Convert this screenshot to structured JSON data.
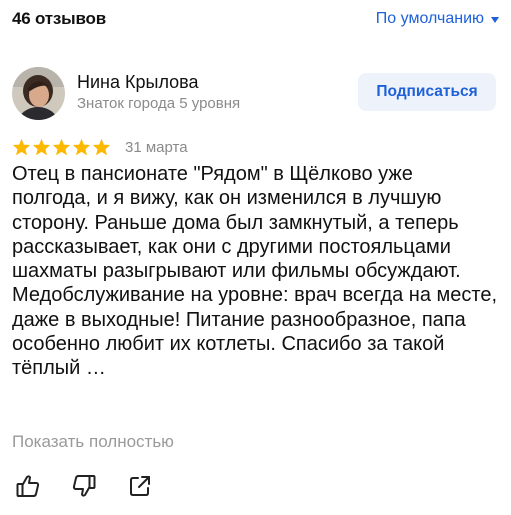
{
  "header": {
    "reviews_count": "46 отзывов",
    "sort_label": "По умолчанию"
  },
  "author": {
    "name": "Нина Крылова",
    "level": "Знаток города 5 уровня",
    "subscribe_label": "Подписаться"
  },
  "review": {
    "rating": 5,
    "max_rating": 5,
    "date": "31 марта",
    "text": "Отец в пансионате \"Рядом\" в Щёлково уже полгода, и я вижу, как он изменился в лучшую сторону. Раньше дома был замкнутый, а теперь рассказывает, как они с другими постояльцами шахматы разыгрывают или фильмы обсуждают. Медобслуживание на уровне: врач всегда на месте, даже в выходные! Питание разнообразное, папа особенно любит их котлеты. Спасибо за такой тёплый …",
    "show_full_label": "Показать полностью"
  },
  "icons": {
    "like": "thumbs-up-icon",
    "dislike": "thumbs-down-icon",
    "share": "share-icon",
    "star": "star-icon",
    "caret": "chevron-down-icon"
  },
  "colors": {
    "accent": "#1e61d9",
    "star": "#fcb900",
    "muted": "#8a8a8a",
    "button_bg": "#eef3fb"
  }
}
